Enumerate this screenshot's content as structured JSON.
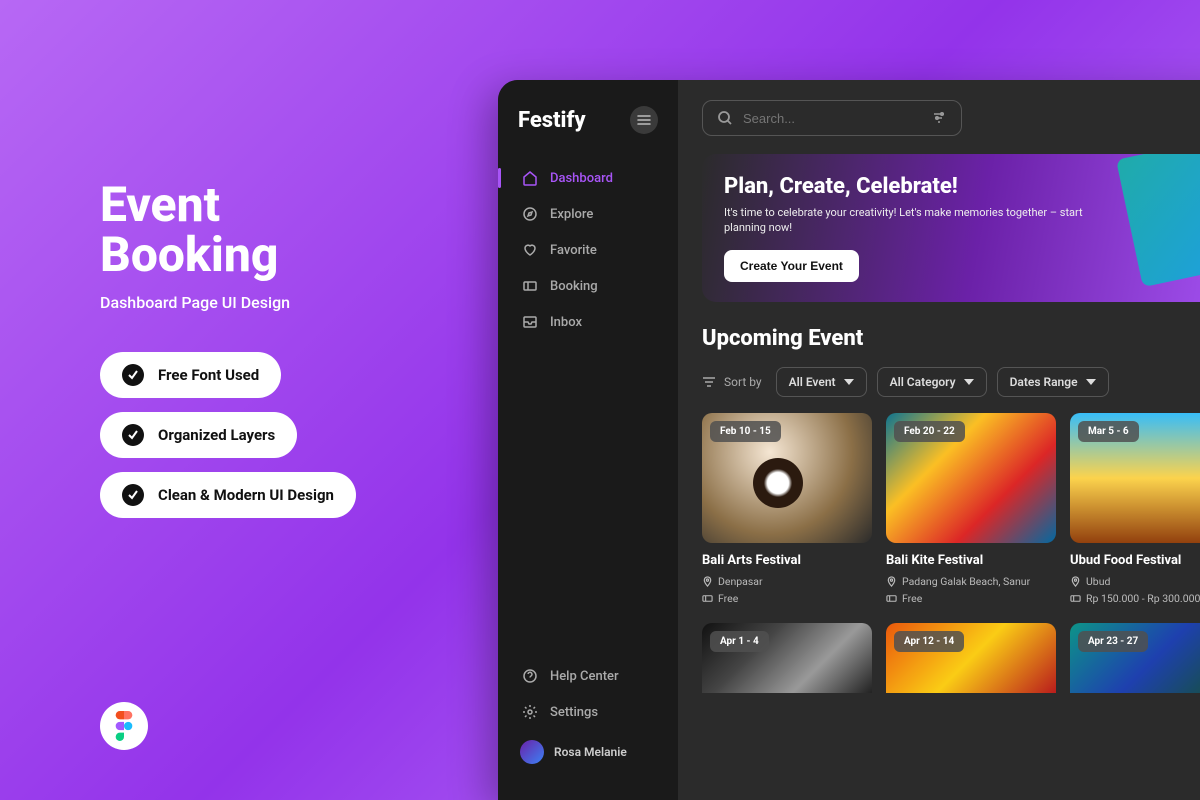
{
  "promo": {
    "title_line1": "Event",
    "title_line2": "Booking",
    "subtitle": "Dashboard Page UI Design",
    "pills": [
      "Free Font Used",
      "Organized Layers",
      "Clean & Modern UI Design"
    ]
  },
  "app_name": "Festify",
  "search": {
    "placeholder": "Search..."
  },
  "sidebar": {
    "items": [
      {
        "label": "Dashboard"
      },
      {
        "label": "Explore"
      },
      {
        "label": "Favorite"
      },
      {
        "label": "Booking"
      },
      {
        "label": "Inbox"
      }
    ],
    "bottom": [
      {
        "label": "Help Center"
      },
      {
        "label": "Settings"
      }
    ],
    "user": "Rosa Melanie"
  },
  "hero": {
    "title": "Plan, Create, Celebrate!",
    "subtitle": "It's time to celebrate your creativity! Let's make memories together – start planning now!",
    "cta": "Create Your Event"
  },
  "section_title": "Upcoming Event",
  "sort_label": "Sort by",
  "filters": [
    "All Event",
    "All Category",
    "Dates Range"
  ],
  "events": [
    {
      "date": "Feb 10 - 15",
      "title": "Bali Arts Festival",
      "location": "Denpasar",
      "price": "Free"
    },
    {
      "date": "Feb 20 - 22",
      "title": "Bali Kite Festival",
      "location": "Padang Galak Beach, Sanur",
      "price": "Free"
    },
    {
      "date": "Mar 5 - 6",
      "title": "Ubud Food Festival",
      "location": "Ubud",
      "price": "Rp 150.000 - Rp 300.000"
    }
  ],
  "events_row2": [
    {
      "date": "Apr 1 - 4"
    },
    {
      "date": "Apr 12 - 14"
    },
    {
      "date": "Apr 23 - 27"
    }
  ]
}
